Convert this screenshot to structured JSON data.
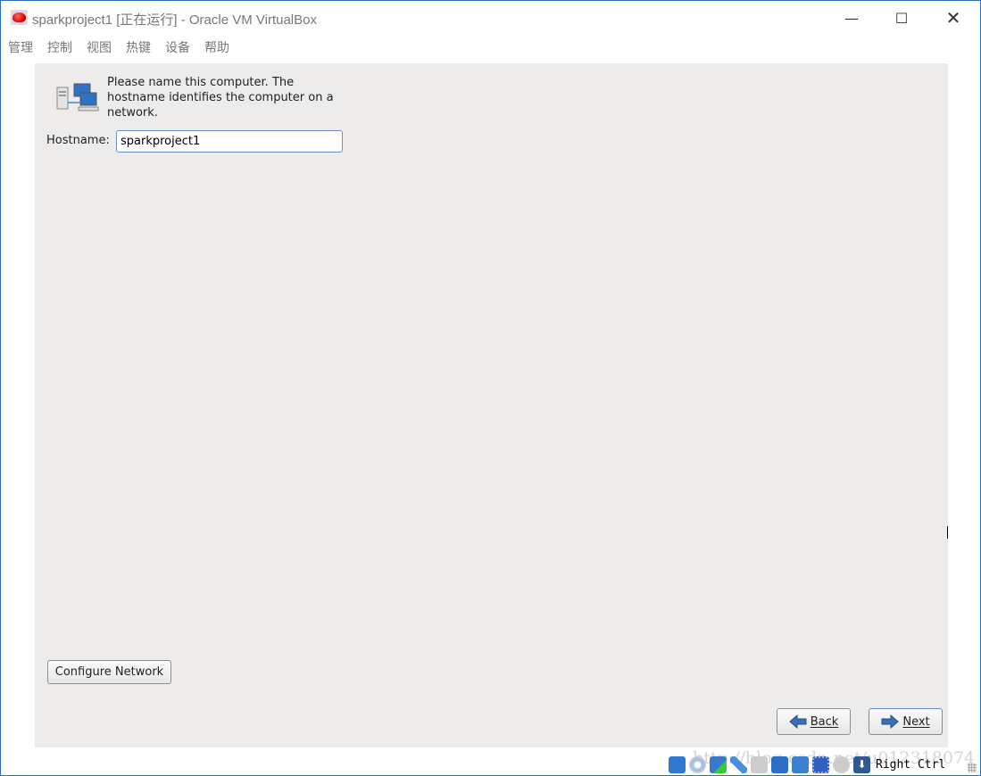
{
  "window": {
    "title": "sparkproject1 [正在运行] - Oracle VM VirtualBox",
    "controls": [
      "minimize",
      "maximize",
      "close"
    ]
  },
  "menu": [
    "管理",
    "控制",
    "视图",
    "热键",
    "设备",
    "帮助"
  ],
  "installer": {
    "prompt": "Please name this computer.  The hostname identifies the computer on a network.",
    "hostname_label": "Hostname:",
    "hostname_value": "sparkproject1",
    "configure_network": "Configure Network",
    "back": "Back",
    "next": "Next"
  },
  "statusbar": {
    "icons": [
      "hard-disk-icon",
      "optical-disc-icon",
      "network-icon",
      "usb-icon",
      "shared-folder-icon",
      "display-icon",
      "video-capture-icon",
      "cpu-icon",
      "mouse-icon",
      "keyboard-icon"
    ],
    "host_key": "Right Ctrl"
  },
  "watermark": "http://blog.csdn.net/u012318074",
  "colors": {
    "window_border": "#2b6cc4",
    "guest_bg": "#edeceb",
    "focus": "#6a8fc8"
  }
}
